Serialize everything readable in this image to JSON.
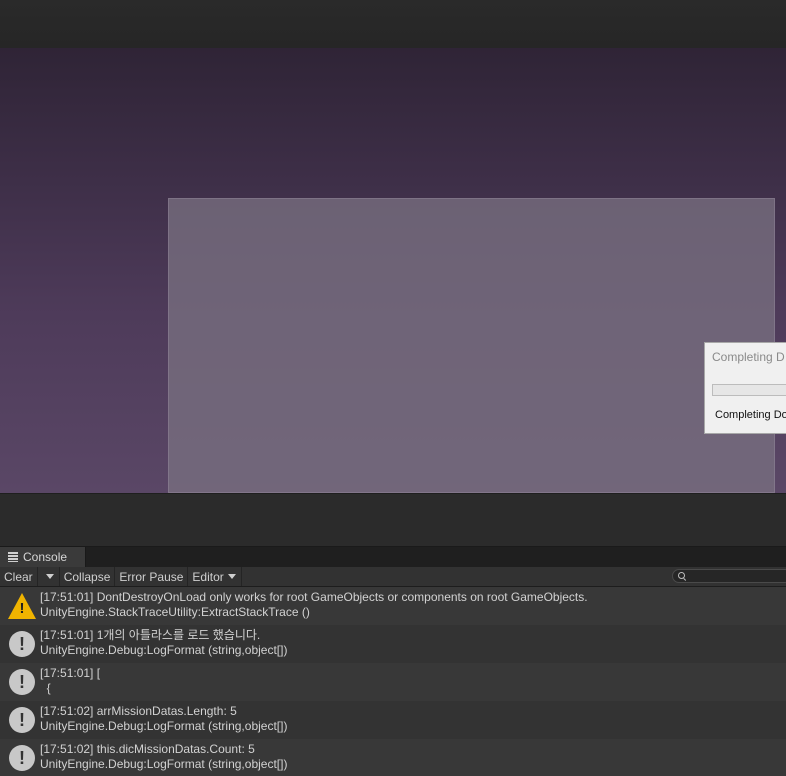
{
  "dialog": {
    "title": "Completing D",
    "message": "Completing Dor",
    "progress": 0
  },
  "console": {
    "tab_label": "Console"
  },
  "toolbar": {
    "clear_label": "Clear",
    "collapse_label": "Collapse",
    "error_pause_label": "Error Pause",
    "editor_label": "Editor",
    "search_value": ""
  },
  "logs": [
    {
      "type": "warning",
      "icon": "warning-icon",
      "line1": "[17:51:01] DontDestroyOnLoad only works for root GameObjects or components on root GameObjects.",
      "line2": "UnityEngine.StackTraceUtility:ExtractStackTrace ()"
    },
    {
      "type": "info",
      "icon": "info-icon",
      "line1": "[17:51:01] 1개의 아틀라스를 로드 했습니다.",
      "line2": "UnityEngine.Debug:LogFormat (string,object[])"
    },
    {
      "type": "info",
      "icon": "info-icon",
      "line1": "[17:51:01] [",
      "line2": "  {"
    },
    {
      "type": "info",
      "icon": "info-icon",
      "line1": "[17:51:02] arrMissionDatas.Length: 5",
      "line2": "UnityEngine.Debug:LogFormat (string,object[])"
    },
    {
      "type": "info",
      "icon": "info-icon",
      "line1": "[17:51:02] this.dicMissionDatas.Count: 5",
      "line2": "UnityEngine.Debug:LogFormat (string,object[])"
    }
  ],
  "colors": {
    "warning": "#f0b400",
    "info": "#c8c8c8"
  }
}
